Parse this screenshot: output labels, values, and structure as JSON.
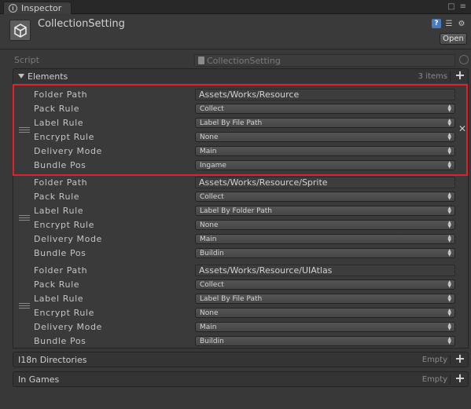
{
  "tab": {
    "title": "Inspector"
  },
  "header": {
    "object_name": "CollectionSetting",
    "open_label": "Open"
  },
  "script": {
    "label": "Script",
    "value": "CollectionSetting"
  },
  "elements_section": {
    "title": "Elements",
    "count": "3 items"
  },
  "field_labels": {
    "folder_path": "Folder Path",
    "pack_rule": "Pack Rule",
    "label_rule": "Label Rule",
    "encrypt_rule": "Encrypt Rule",
    "delivery_mode": "Delivery Mode",
    "bundle_pos": "Bundle Pos"
  },
  "elements": [
    {
      "folder_path": "Assets/Works/Resource",
      "pack_rule": "Collect",
      "label_rule": "Label By File Path",
      "encrypt_rule": "None",
      "delivery_mode": "Main",
      "bundle_pos": "Ingame"
    },
    {
      "folder_path": "Assets/Works/Resource/Sprite",
      "pack_rule": "Collect",
      "label_rule": "Label By Folder Path",
      "encrypt_rule": "None",
      "delivery_mode": "Main",
      "bundle_pos": "Buildin"
    },
    {
      "folder_path": "Assets/Works/Resource/UIAtlas",
      "pack_rule": "Collect",
      "label_rule": "Label By File Path",
      "encrypt_rule": "None",
      "delivery_mode": "Main",
      "bundle_pos": "Buildin"
    }
  ],
  "i18n_section": {
    "title": "I18n Directories",
    "count": "Empty"
  },
  "ingames_section": {
    "title": "In Games",
    "count": "Empty"
  },
  "colors": {
    "highlight": "#e0202a",
    "background": "#383838"
  }
}
